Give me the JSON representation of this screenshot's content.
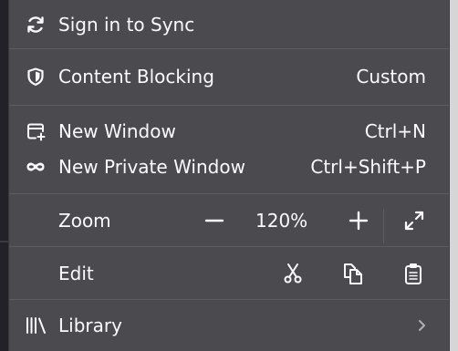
{
  "menu": {
    "sync_label": "Sign in to Sync",
    "content_blocking_label": "Content Blocking",
    "content_blocking_value": "Custom",
    "new_window_label": "New Window",
    "new_window_shortcut": "Ctrl+N",
    "new_private_window_label": "New Private Window",
    "new_private_window_shortcut": "Ctrl+Shift+P",
    "zoom_label": "Zoom",
    "zoom_value": "120%",
    "edit_label": "Edit",
    "library_label": "Library"
  },
  "icons": {
    "sync": "sync-icon",
    "content_blocking": "shield-icon",
    "new_window": "new-window-icon",
    "private_window": "private-mask-icon",
    "zoom_out": "minus-icon",
    "zoom_in": "plus-icon",
    "fullscreen": "fullscreen-icon",
    "cut": "scissors-icon",
    "copy": "copy-icon",
    "paste": "clipboard-icon",
    "library": "library-icon",
    "submenu": "chevron-right-icon"
  },
  "colors": {
    "panel_background": "#4a4a4f",
    "text": "#fbfbfe",
    "separator": "#5c5c61",
    "chevron": "#b1b1b3"
  }
}
